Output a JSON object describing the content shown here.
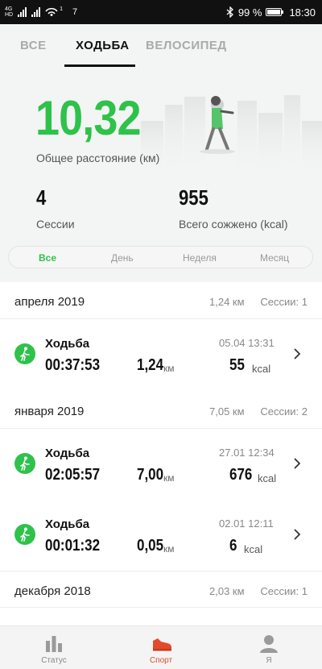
{
  "status_bar": {
    "network_top": "4G",
    "network_bottom": "HD",
    "notification_count": "7",
    "hotspot_badge": "1",
    "battery": "99 %",
    "time": "18:30"
  },
  "tabs": [
    {
      "label": "ВСЕ",
      "active": false
    },
    {
      "label": "ХОДЬБА",
      "active": true
    },
    {
      "label": "ВЕЛОСИПЕД",
      "active": false
    }
  ],
  "summary": {
    "total_distance": "10,32",
    "total_distance_label": "Общее расстояние (км)",
    "sessions": "4",
    "sessions_label": "Сессии",
    "burned": "955",
    "burned_label": "Всего сожжено (kcal)"
  },
  "period_filter": [
    {
      "label": "Все",
      "active": true
    },
    {
      "label": "День",
      "active": false
    },
    {
      "label": "Неделя",
      "active": false
    },
    {
      "label": "Месяц",
      "active": false
    }
  ],
  "groups": [
    {
      "month": "апреля 2019",
      "distance": "1,24 км",
      "sessions": "Сессии: 1",
      "items": [
        {
          "title": "Ходьба",
          "date": "05.04 13:31",
          "duration": "00:37:53",
          "distance": "1,24",
          "distance_unit": "км",
          "kcal": "55",
          "kcal_unit": "kcal"
        }
      ]
    },
    {
      "month": "января 2019",
      "distance": "7,05 км",
      "sessions": "Сессии: 2",
      "items": [
        {
          "title": "Ходьба",
          "date": "27.01 12:34",
          "duration": "02:05:57",
          "distance": "7,00",
          "distance_unit": "км",
          "kcal": "676",
          "kcal_unit": "kcal"
        },
        {
          "title": "Ходьба",
          "date": "02.01 12:11",
          "duration": "00:01:32",
          "distance": "0,05",
          "distance_unit": "км",
          "kcal": "6",
          "kcal_unit": "kcal"
        }
      ]
    },
    {
      "month": "декабря 2018",
      "distance": "2,03 км",
      "sessions": "Сессии: 1",
      "items": []
    }
  ],
  "bottom_nav": [
    {
      "label": "Статус",
      "icon": "bar-chart-icon",
      "active": false
    },
    {
      "label": "Спорт",
      "icon": "sneaker-icon",
      "active": true
    },
    {
      "label": "Я",
      "icon": "person-icon",
      "active": false
    }
  ],
  "colors": {
    "accent_green": "#2ec24a",
    "active_nav": "#e34a2a",
    "header_bg": "#f3f4f4"
  }
}
